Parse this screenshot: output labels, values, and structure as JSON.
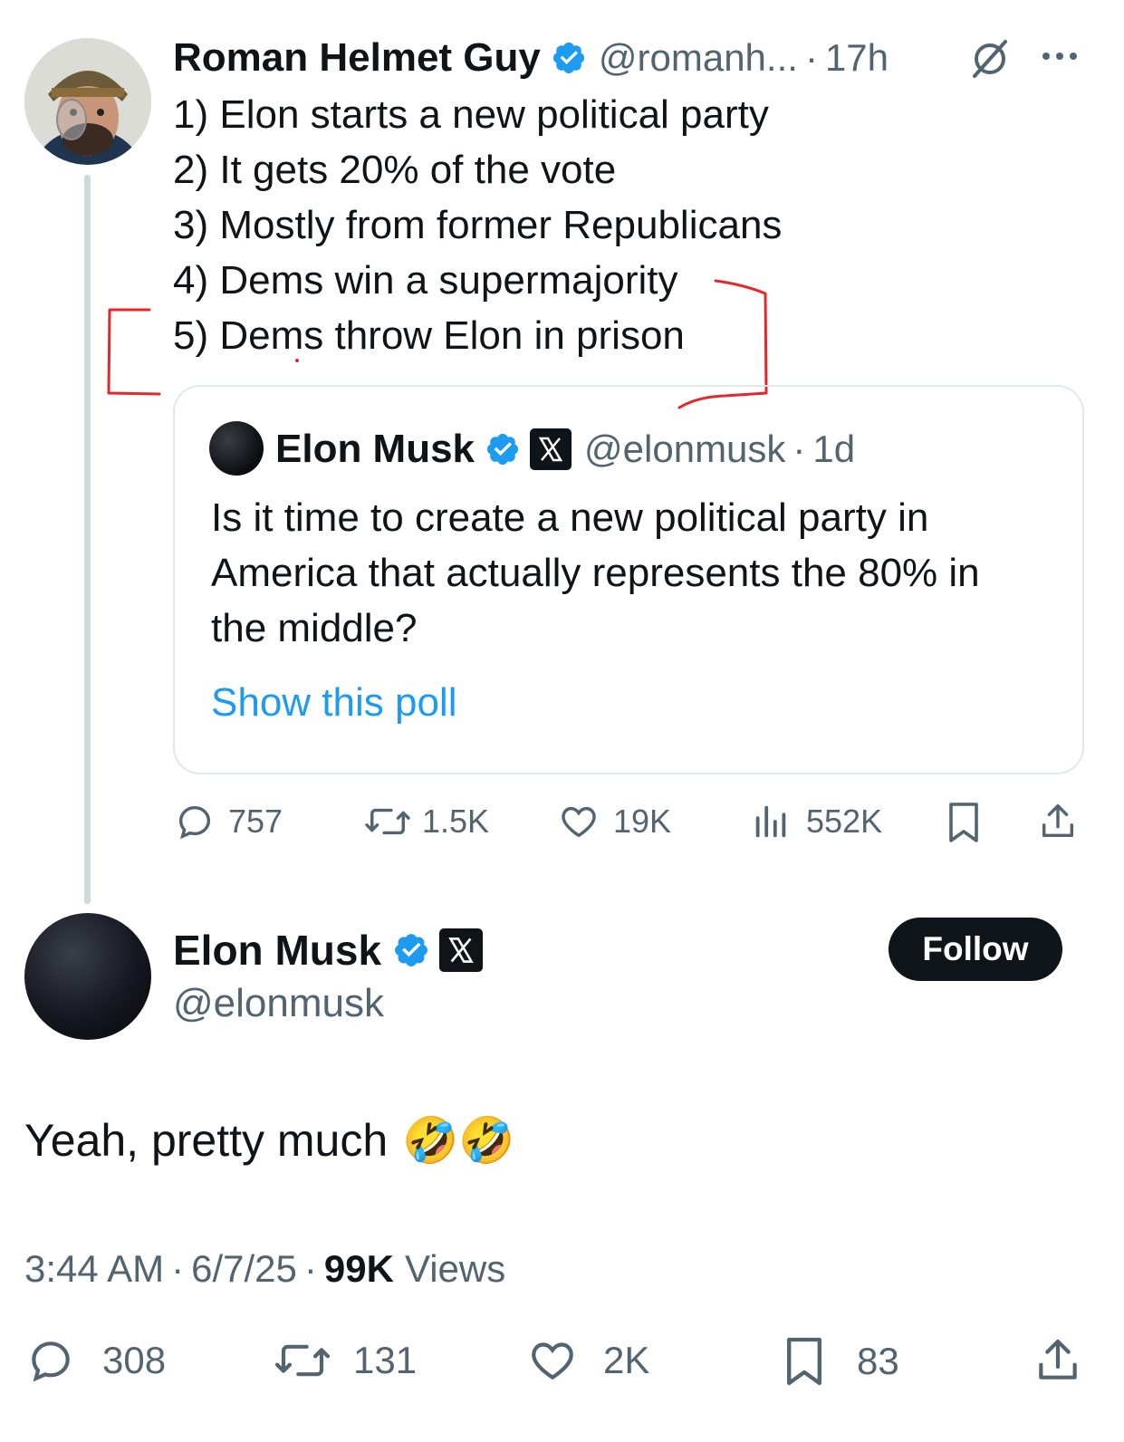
{
  "thread_tweet": {
    "author_name": "Roman Helmet Guy",
    "author_handle": "@romanh...",
    "dot": "·",
    "time": "17h",
    "lines": [
      "1) Elon starts a new political party",
      "2) It gets 20% of the vote",
      "3) Mostly from former Republicans",
      "4) Dems win a supermajority",
      "5) Dems throw Elon in prison"
    ],
    "quote": {
      "author_name": "Elon Musk",
      "author_handle": "@elonmusk",
      "dot": "·",
      "time": "1d",
      "text": "Is it time to create a new political party in America that actually represents the 80% in the middle?",
      "text_lines": [
        "Is it time to create a new political party in",
        "America that actually represents the 80% in",
        "the middle?"
      ],
      "poll_link": "Show this poll"
    },
    "stats": {
      "replies": "757",
      "reposts": "1.5K",
      "likes": "19K",
      "views": "552K"
    }
  },
  "main_tweet": {
    "author_name": "Elon Musk",
    "author_handle": "@elonmusk",
    "follow_label": "Follow",
    "text": "Yeah, pretty much",
    "emoji": "🤣🤣",
    "time": "3:44 AM",
    "date": "6/7/25",
    "dot": "·",
    "views_count": "99K",
    "views_label": "Views",
    "stats": {
      "replies": "308",
      "reposts": "131",
      "likes": "2K",
      "bookmarks": "83"
    }
  },
  "colors": {
    "text": "#0f1419",
    "muted": "#536471",
    "link": "#1d9bf0",
    "verified": "#1d9bf0",
    "annotation": "#e8262a",
    "border": "#e1e8ed"
  },
  "icons": [
    "verified-badge-icon",
    "x-logo-icon",
    "grok-icon",
    "more-icon",
    "reply-icon",
    "repost-icon",
    "like-icon",
    "views-icon",
    "bookmark-icon",
    "share-icon"
  ]
}
